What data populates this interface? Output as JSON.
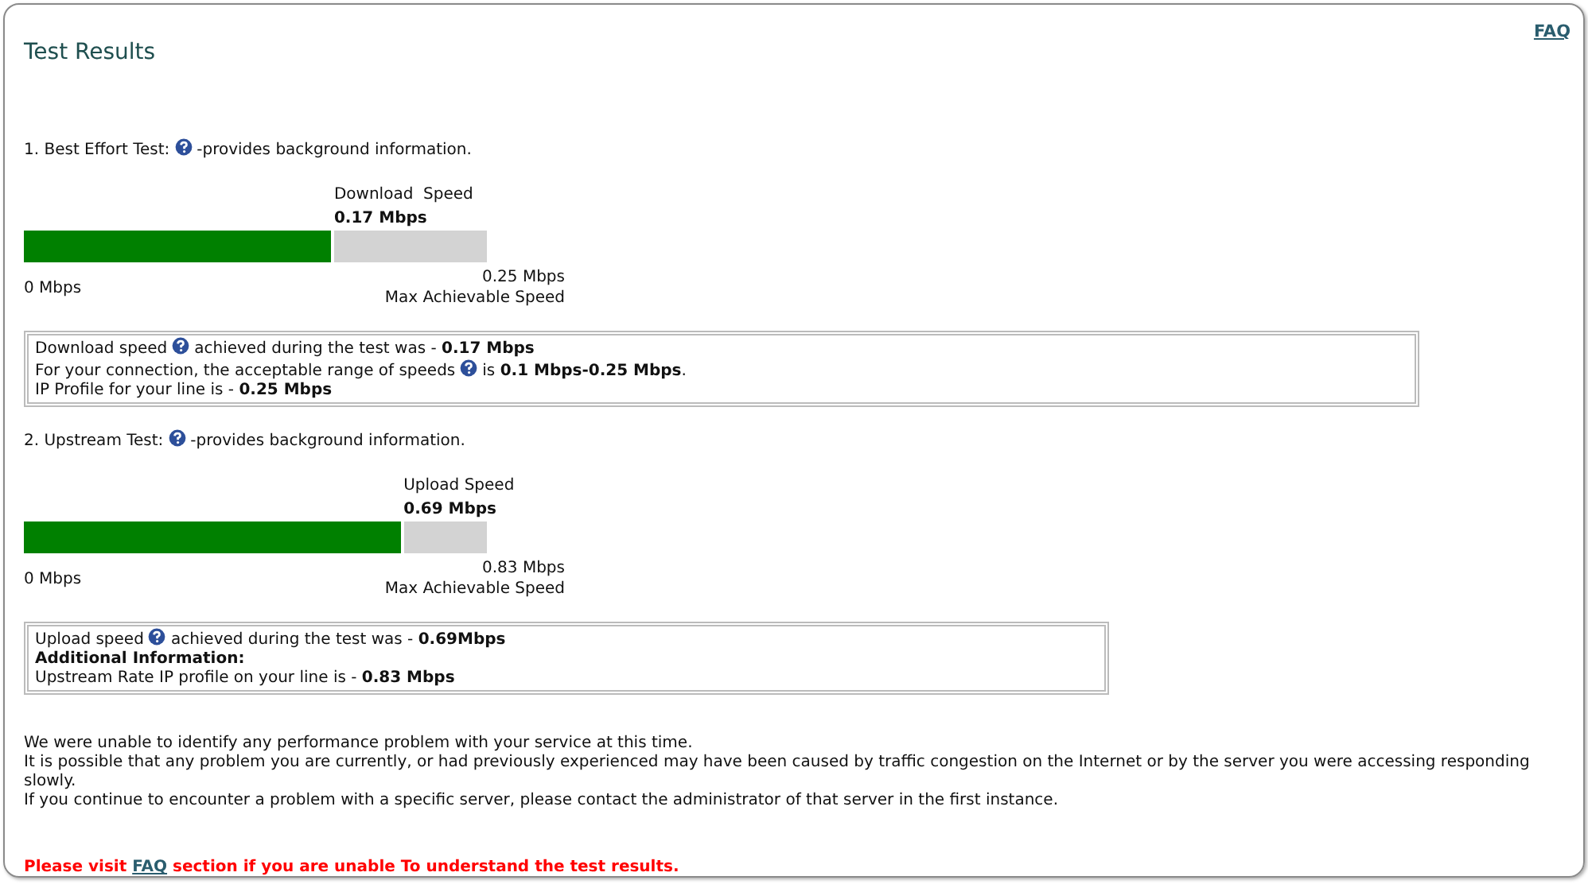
{
  "header": {
    "title": "Test Results",
    "faq_link": "FAQ"
  },
  "tests": [
    {
      "heading": [
        {
          "kind": "text",
          "text": "1. Best Effort Test:"
        },
        {
          "kind": "help"
        },
        {
          "kind": "text",
          "text": "-provides background information."
        }
      ],
      "speed_label": "Download  Speed",
      "speed_value": "0.17 Mbps",
      "level": 0.67,
      "min_label": "0 Mbps",
      "max_value": "0.25 Mbps",
      "max_label": "Max Achievable Speed",
      "info_lines": [
        [
          {
            "kind": "text",
            "text": "Download speed"
          },
          {
            "kind": "help"
          },
          {
            "kind": "text",
            "text": "achieved during the test was - **0.17 Mbps**"
          }
        ],
        [
          {
            "kind": "text",
            "text": "For your connection, the acceptable range of speeds"
          },
          {
            "kind": "help"
          },
          {
            "kind": "text",
            "text": "is **0.1 Mbps-0.25 Mbps**."
          }
        ],
        [
          {
            "kind": "text",
            "text": "IP Profile for your line is - **0.25 Mbps**"
          }
        ]
      ]
    },
    {
      "heading": [
        {
          "kind": "text",
          "text": "2. Upstream Test:"
        },
        {
          "kind": "help"
        },
        {
          "kind": "text",
          "text": "-provides background information."
        }
      ],
      "speed_label": "Upload Speed",
      "speed_value": "0.69 Mbps",
      "level": 0.82,
      "min_label": "0 Mbps",
      "max_value": "0.83 Mbps",
      "max_label": "Max Achievable Speed",
      "info_lines": [
        [
          {
            "kind": "text",
            "text": "Upload speed"
          },
          {
            "kind": "help"
          },
          {
            "kind": "text",
            "text": "achieved during the test was - **0.69Mbps**"
          }
        ],
        [
          {
            "kind": "strong",
            "text": "Additional Information:"
          }
        ],
        [
          {
            "kind": "text",
            "text": "Upstream Rate IP profile on your line is - **0.83 Mbps**"
          }
        ]
      ]
    }
  ],
  "summary": [
    "We were unable to identify any performance problem with your service at this time.",
    "It is possible that any problem you are currently, or had previously experienced may have been caused by traffic congestion on the Internet or by the server you were accessing responding slowly.",
    "If you continue to encounter a problem with a specific server, please contact the administrator of that server in the first instance."
  ],
  "notice": {
    "before": "Please visit",
    "link": "FAQ",
    "after": "section if you are unable To understand the test results."
  }
}
